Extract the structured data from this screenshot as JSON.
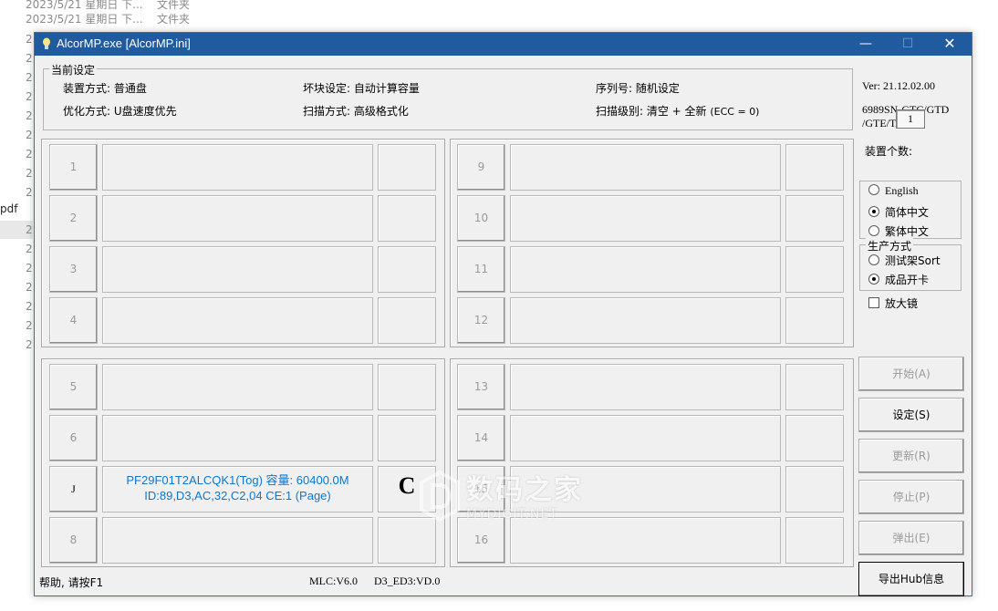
{
  "background": {
    "rows": [
      {
        "date": "2023/5/21 星期日 下...",
        "type": "文件夹"
      },
      {
        "date": "2023/5/21 星期日 下...",
        "type": "文件夹"
      }
    ],
    "left_fragment": "2",
    "pdf_fragment": "pdf"
  },
  "window": {
    "title": "AlcorMP.exe [AlcorMP.ini]",
    "minimize": "—",
    "maximize": "☐",
    "close": "✕"
  },
  "current_settings": {
    "label": "当前设定",
    "device_mode": "装置方式: 普通盘",
    "bad_block": "坏块设定: 自动计算容量",
    "serial": "序列号: 随机设定",
    "optimize": "优化方式: U盘速度优先",
    "scan_mode": "扫描方式: 高级格式化",
    "scan_level": "扫描级别: 清空 + 全新",
    "scan_level_ecc": "(ECC = 0)"
  },
  "info": {
    "version": "Ver: 21.12.02.00",
    "chip_line1": "6989SN-GTC/GTD",
    "chip_line2": "/GTE/TA",
    "device_count_label": "装置个数:",
    "device_count": "1"
  },
  "language": {
    "options": [
      "English",
      "简体中文",
      "繁体中文"
    ],
    "selected": "简体中文"
  },
  "production": {
    "label": "生产方式",
    "options": [
      "测试架Sort",
      "成品开卡"
    ],
    "selected": "成品开卡"
  },
  "magnifier": "放大镜",
  "ports": {
    "top_left": [
      "1",
      "2",
      "3",
      "4"
    ],
    "top_right": [
      "9",
      "10",
      "11",
      "12"
    ],
    "bottom_left": [
      "5",
      "6",
      "J",
      "8"
    ],
    "bottom_right": [
      "13",
      "14",
      "15",
      "16"
    ]
  },
  "active_port": {
    "line1": "PF29F01T2ALCQK1(Tog) 容量: 60400.0M",
    "line2": "ID:89,D3,AC,32,C2,04 CE:1 (Page)",
    "result": "C"
  },
  "buttons": {
    "start": "开始(A)",
    "settings": "设定(S)",
    "update": "更新(R)",
    "stop": "停止(P)",
    "eject": "弹出(E)",
    "export": "导出Hub信息"
  },
  "status": {
    "help": "帮助, 请按F1",
    "mlc": "MLC:V6.0",
    "firmware": "D3_ED3:VD.0"
  },
  "watermark": {
    "text": "数码之家",
    "sub": "MYDIGIT.NET"
  }
}
